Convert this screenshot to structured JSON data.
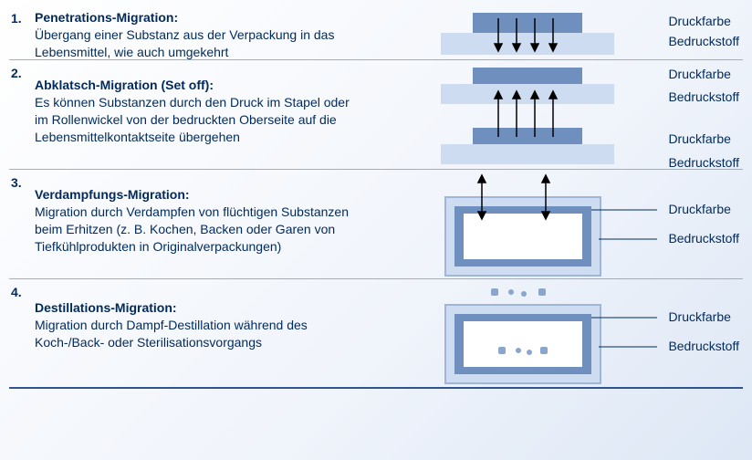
{
  "labels": {
    "ink": "Druckfarbe",
    "substrate": "Bedruckstoff"
  },
  "items": [
    {
      "num": "1.",
      "title": "Penetrations-Migration:",
      "desc": "Übergang einer Substanz aus der Verpackung in das Lebensmittel, wie auch umgekehrt"
    },
    {
      "num": "2.",
      "title": "Abklatsch-Migration (Set off):",
      "desc": "Es können Substanzen durch den Druck im Stapel oder im Rollenwickel von der bedruckten Oberseite auf die Lebensmittelkontaktseite übergehen"
    },
    {
      "num": "3.",
      "title": "Verdampfungs-Migration:",
      "desc": "Migration durch Verdampfen von flüchtigen Sub­stanzen beim Erhitzen (z. B. Kochen, Backen oder Garen von Tiefkühlprodukten in Originalverpackungen)"
    },
    {
      "num": "4.",
      "title": "Destillations-Migration:",
      "desc": "Migration durch Dampf-Destillation während des Koch-/Back- oder Sterilisationsvorgangs"
    }
  ]
}
